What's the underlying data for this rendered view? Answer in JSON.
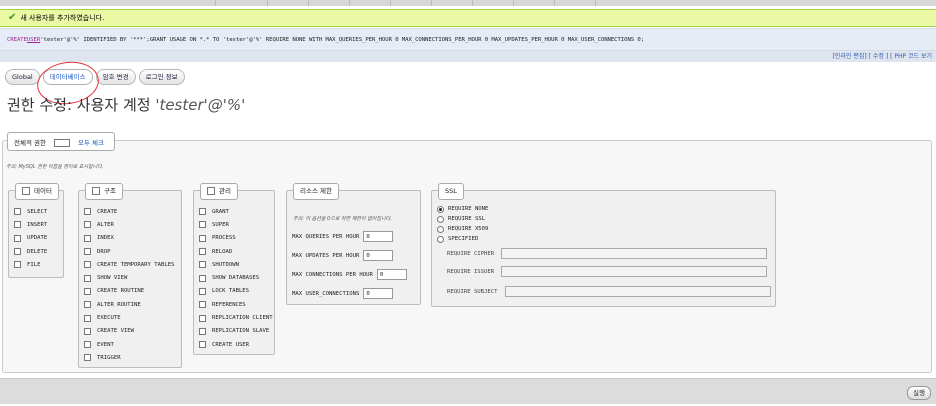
{
  "success_message": "새 사용자를 추가하였습니다.",
  "sql": {
    "part1": "CREATE ",
    "part2": "USER",
    "part3": " 'tester'@'%' IDENTIFIED BY '***';GRANT USAGE ON *.* TO 'tester'@'%' REQUIRE NONE WITH MAX_QUERIES_PER_HOUR 0 MAX_CONNECTIONS_PER_HOUR 0 MAX_UPDATES_PER_HOUR 0 MAX_USER_CONNECTIONS 0;",
    "actions": "[인라인 편집] [ 수정 ] [ PHP 코드 보기"
  },
  "tabs": [
    {
      "label": "Global"
    },
    {
      "label": "데이터베이스"
    },
    {
      "label": "암호 변경"
    },
    {
      "label": "로그인 정보"
    }
  ],
  "page_title": {
    "prefix": "권한 수정: 사용자 계정 ",
    "account": "'tester'@'%'"
  },
  "global_privs": {
    "label": "전체적 권한",
    "check_all": "모두 체크"
  },
  "note": "주의: MySQL 권한 이름을 영어로 표시합니다.",
  "groups": {
    "data": {
      "title": "데이터",
      "items": [
        "SELECT",
        "INSERT",
        "UPDATE",
        "DELETE",
        "FILE"
      ]
    },
    "structure": {
      "title": "구조",
      "items": [
        "CREATE",
        "ALTER",
        "INDEX",
        "DROP",
        "CREATE TEMPORARY TABLES",
        "SHOW VIEW",
        "CREATE ROUTINE",
        "ALTER ROUTINE",
        "EXECUTE",
        "CREATE VIEW",
        "EVENT",
        "TRIGGER"
      ]
    },
    "admin": {
      "title": "관리",
      "items": [
        "GRANT",
        "SUPER",
        "PROCESS",
        "RELOAD",
        "SHUTDOWN",
        "SHOW DATABASES",
        "LOCK TABLES",
        "REFERENCES",
        "REPLICATION CLIENT",
        "REPLICATION SLAVE",
        "CREATE USER"
      ]
    }
  },
  "resource": {
    "title": "리소스 제한",
    "note": "주의: 이 옵션을 0으로 하면 제한이 없어집니다.",
    "rows": [
      {
        "label": "MAX QUERIES PER HOUR",
        "value": "0"
      },
      {
        "label": "MAX UPDATES PER HOUR",
        "value": "0"
      },
      {
        "label": "MAX CONNECTIONS PER HOUR",
        "value": "0"
      },
      {
        "label": "MAX USER_CONNECTIONS",
        "value": "0"
      }
    ]
  },
  "ssl": {
    "title": "SSL",
    "options": [
      "REQUIRE NONE",
      "REQUIRE SSL",
      "REQUIRE X509",
      "SPECIFIED"
    ],
    "fields": [
      "REQUIRE CIPHER",
      "REQUIRE ISSUER",
      "REQUIRE SUBJECT"
    ]
  },
  "submit_label": "실행"
}
